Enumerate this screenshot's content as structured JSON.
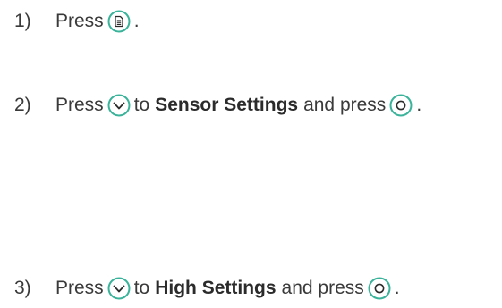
{
  "steps": [
    {
      "number": "1)",
      "text_before": "Press",
      "icon": "menu-button-icon",
      "text_after": "."
    },
    {
      "number": "2)",
      "text_before": "Press",
      "icon1": "down-arrow-button-icon",
      "to_word": "to",
      "target": "Sensor Settings",
      "and_press": "and press",
      "icon2": "ok-button-icon",
      "text_after": "."
    },
    {
      "number": "3)",
      "text_before": "Press",
      "icon1": "down-arrow-button-icon",
      "to_word": "to",
      "target": "High Settings",
      "and_press": "and press",
      "icon2": "ok-button-icon",
      "text_after": "."
    }
  ],
  "colors": {
    "icon_green": "#3bb39a",
    "text": "#3a3a3a"
  }
}
